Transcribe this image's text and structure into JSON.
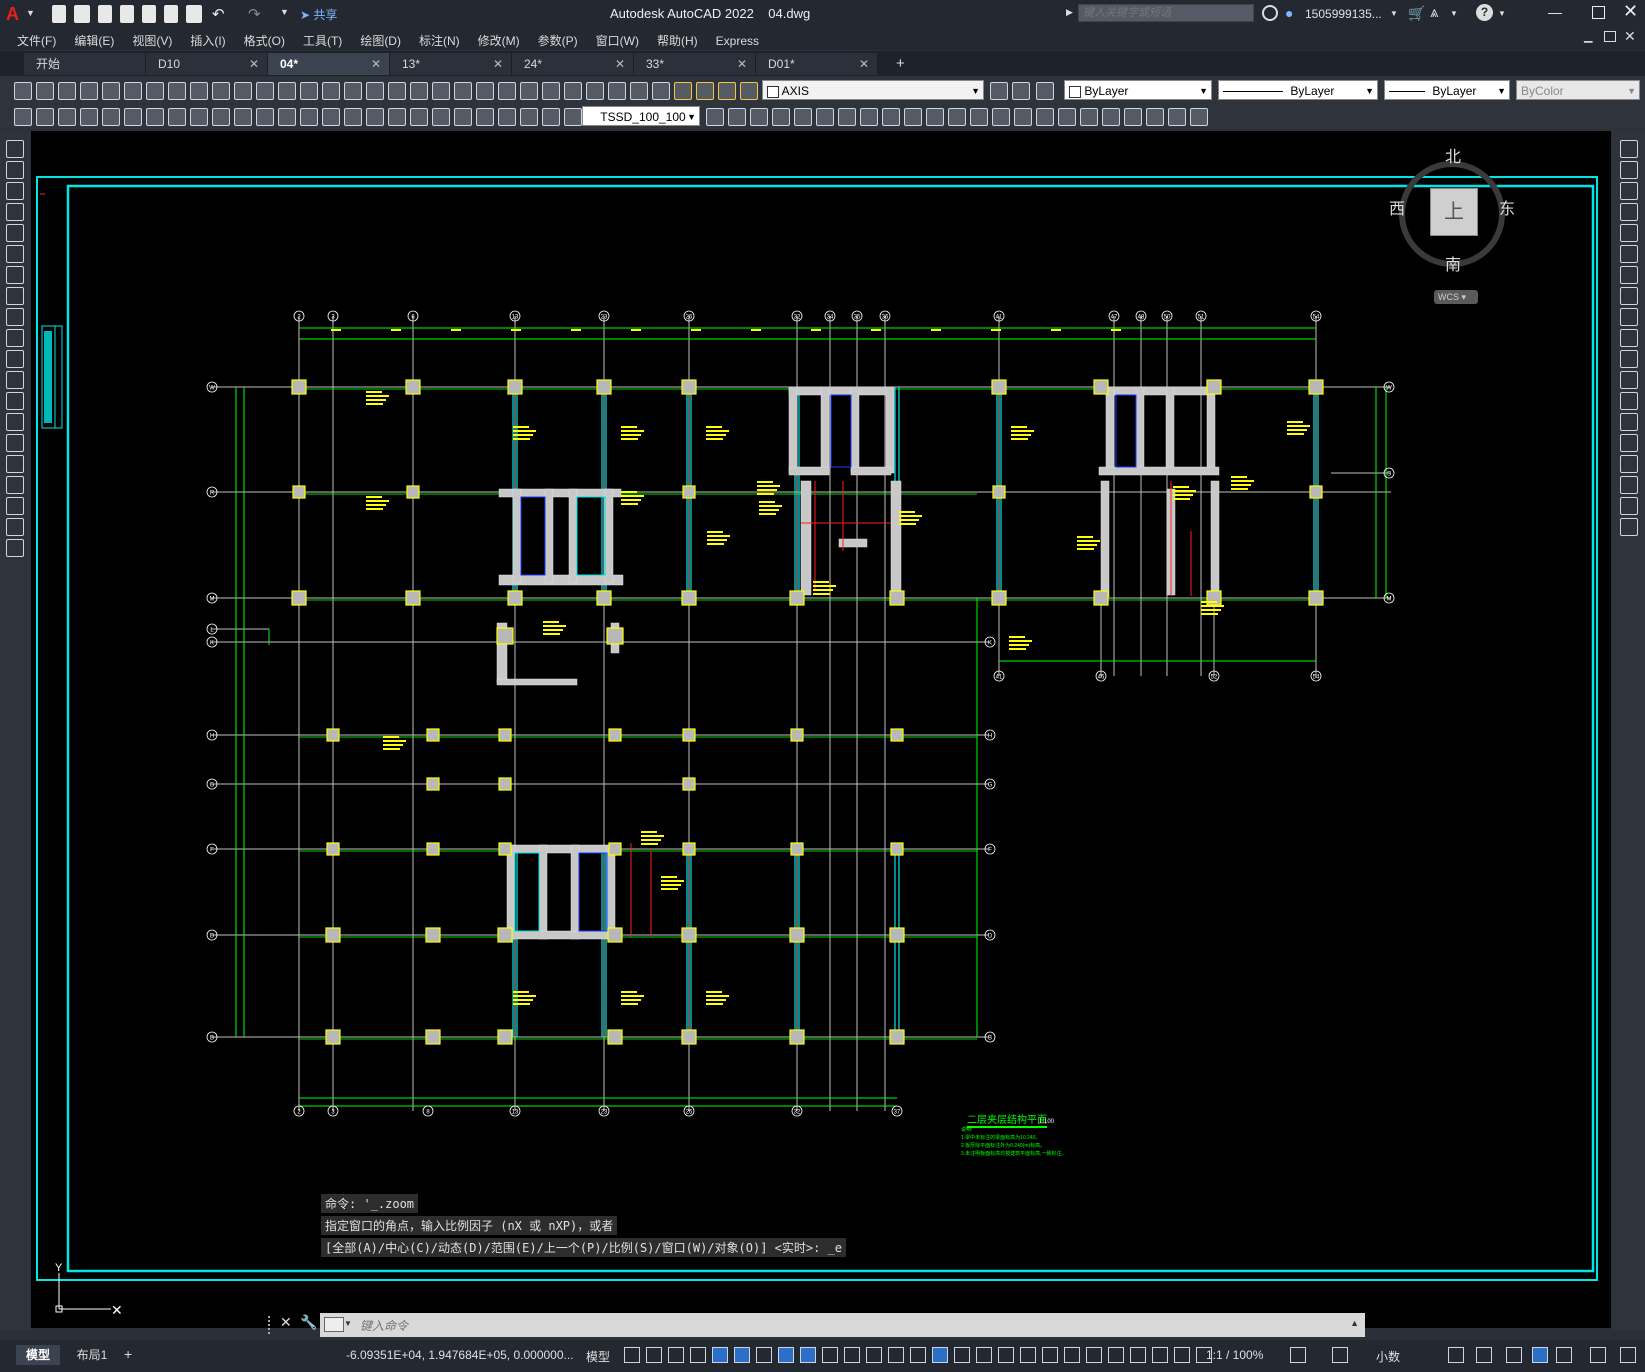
{
  "app": {
    "title": "Autodesk AutoCAD 2022    04.dwg",
    "share": "共享",
    "search_placeholder": "键入关键字或短语",
    "user": "1505999135...",
    "logo": "A"
  },
  "menu": [
    "文件(F)",
    "编辑(E)",
    "视图(V)",
    "插入(I)",
    "格式(O)",
    "工具(T)",
    "绘图(D)",
    "标注(N)",
    "修改(M)",
    "参数(P)",
    "窗口(W)",
    "帮助(H)",
    "Express"
  ],
  "tabs": [
    {
      "label": "开始",
      "close": false,
      "active": false
    },
    {
      "label": "D10",
      "close": true,
      "active": false
    },
    {
      "label": "04*",
      "close": true,
      "active": true
    },
    {
      "label": "13*",
      "close": true,
      "active": false
    },
    {
      "label": "24*",
      "close": true,
      "active": false
    },
    {
      "label": "33*",
      "close": true,
      "active": false
    },
    {
      "label": "D01*",
      "close": true,
      "active": false
    }
  ],
  "toolbar": {
    "layer": "AXIS",
    "color": "ByLayer",
    "linetype": "ByLayer",
    "lineweight": "ByLayer",
    "plotstyle": "ByColor",
    "dimstyle": "TSSD_100_100"
  },
  "viewcube": {
    "north": "北",
    "south": "南",
    "east": "东",
    "west": "西",
    "top": "上",
    "wcs": "WCS"
  },
  "axes": {
    "top": [
      "2",
      "3",
      "6",
      "13",
      "23",
      "26",
      "32",
      "34",
      "35",
      "36",
      "41",
      "47",
      "48",
      "50",
      "51",
      "54"
    ],
    "bottom": [
      "2",
      "3",
      "8",
      "13",
      "23",
      "26",
      "32",
      "37"
    ],
    "bottom_right": [
      "41",
      "46",
      "52",
      "54"
    ],
    "left": [
      "W",
      "R",
      "M",
      "L",
      "K",
      "H",
      "G",
      "F",
      "D",
      "B"
    ],
    "right_upper": [
      "W",
      "S",
      "M"
    ],
    "right_lower": [
      "K",
      "H",
      "G",
      "F",
      "D",
      "B"
    ]
  },
  "drawing_title": "二层夹层结构平面",
  "drawing_scale": "1:100",
  "notes": [
    "说明:",
    "1.梁中未标注的梁面标高为10.240。",
    "2.板厚除平面标注外为0.240(m)标高。",
    "3.未注明板面标高均按建筑平面标高,一致标注。"
  ],
  "command_history": [
    "命令: '_.zoom",
    "指定窗口的角点，输入比例因子 (nX 或 nXP)，或者",
    "[全部(A)/中心(C)/动态(D)/范围(E)/上一个(P)/比例(S)/窗口(W)/对象(O)] <实时>: _e"
  ],
  "command_placeholder": "键入命令",
  "layout_tabs": [
    "模型",
    "布局1"
  ],
  "status": {
    "coords": "-6.09351E+04, 1.947684E+05, 0.000000...",
    "model": "模型",
    "scale": "1:1 / 100%",
    "units": "小数"
  },
  "colors": {
    "cyan": "#00e5e5",
    "green": "#00ff00",
    "yellow": "#ffff00",
    "gray": "#c8c8c8",
    "blue": "#1a3dff",
    "red": "#ff2020",
    "white": "#ffffff"
  }
}
